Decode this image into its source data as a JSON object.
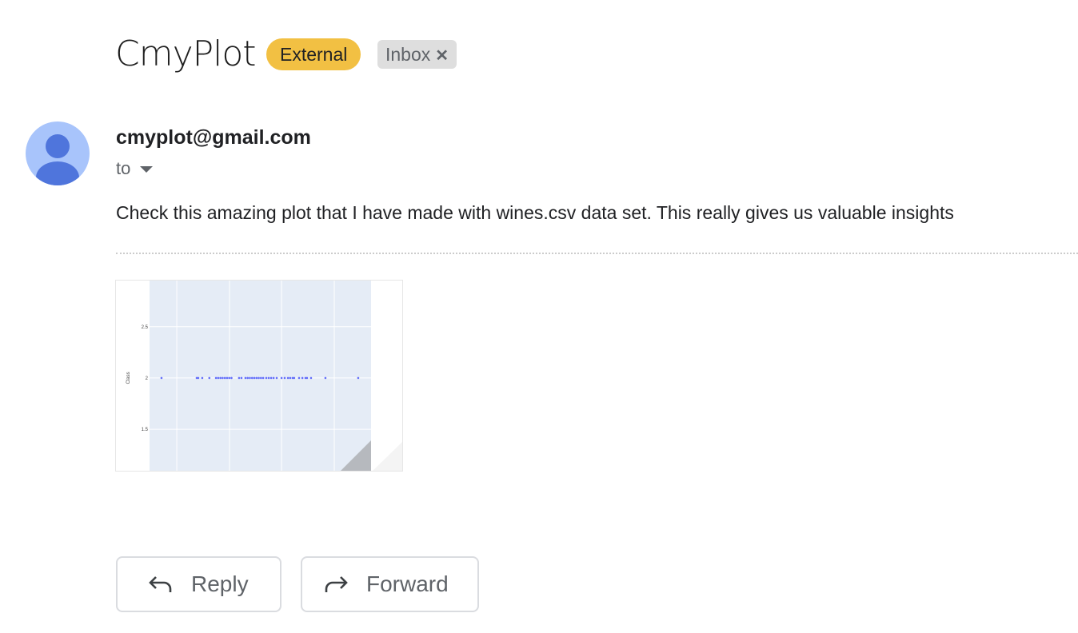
{
  "email": {
    "subject": "CmyPlot",
    "labels": [
      {
        "text": "External",
        "color": "#f2c043"
      },
      {
        "text": "Inbox",
        "removable": true
      }
    ],
    "remove_label_glyph": "✕",
    "sender": "cmyplot@gmail.com",
    "to_label": "to",
    "body": "Check this amazing plot that I have made with wines.csv data set. This really gives us valuable insights"
  },
  "actions": {
    "reply": "Reply",
    "forward": "Forward"
  },
  "chart_data": {
    "type": "scatter",
    "title": "",
    "xlabel": "",
    "ylabel": "Class",
    "ylim": [
      1.08,
      2.95
    ],
    "xlim": [
      0,
      100
    ],
    "yticks": [
      "1.5",
      "2",
      "2.5"
    ],
    "ytick_values": [
      1.5,
      2,
      2.5
    ],
    "xgrid": [
      12.3,
      36.1,
      59.6,
      83.4
    ],
    "grid": true,
    "marker_color": "#636efa",
    "plot_bg": "#e5ecf6",
    "x": [
      5.4,
      21.3,
      22,
      23.8,
      27,
      30,
      31,
      32,
      33,
      34,
      35,
      36,
      37,
      40.4,
      41.5,
      43.3,
      44.3,
      45.3,
      46.3,
      47.3,
      48.3,
      49.3,
      50.3,
      51.3,
      52.7,
      53.8,
      54.9,
      56,
      57.4,
      59.6,
      61,
      62.5,
      63.5,
      64.6,
      65.3,
      67.5,
      69,
      70.4,
      71.1,
      72.9,
      79.4,
      94.2
    ],
    "y": [
      2,
      2,
      2,
      2,
      2,
      2,
      2,
      2,
      2,
      2,
      2,
      2,
      2,
      2,
      2,
      2,
      2,
      2,
      2,
      2,
      2,
      2,
      2,
      2,
      2,
      2,
      2,
      2,
      2,
      2,
      2,
      2,
      2,
      2,
      2,
      2,
      2,
      2,
      2,
      2,
      2,
      2
    ]
  }
}
